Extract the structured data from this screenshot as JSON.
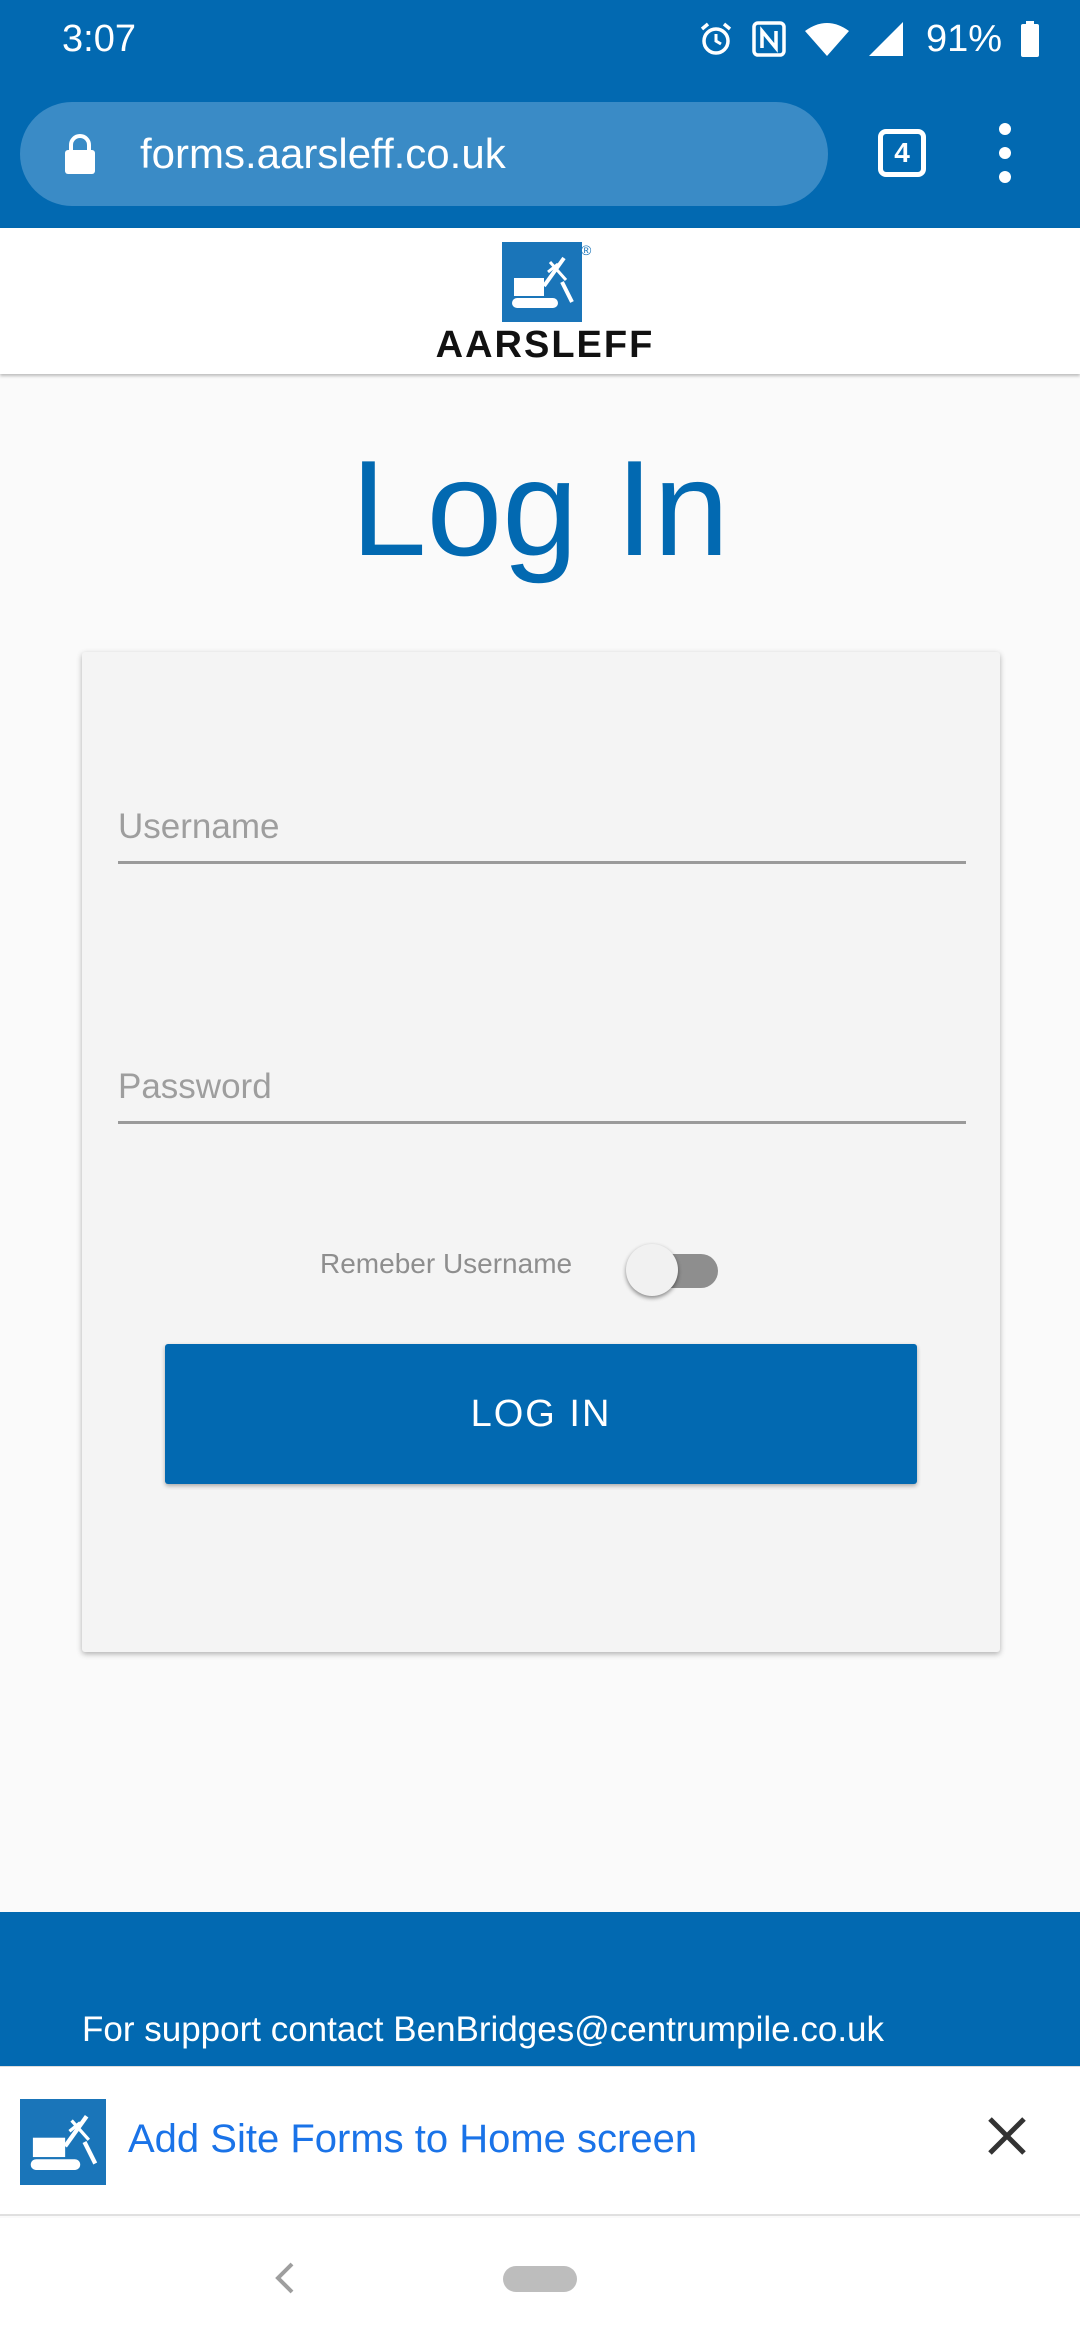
{
  "status_bar": {
    "time": "3:07",
    "battery": "91%",
    "icons": [
      "alarm-icon",
      "nfc-icon",
      "wifi-icon",
      "signal-icon",
      "battery-icon"
    ]
  },
  "browser": {
    "url": "forms.aarsleff.co.uk",
    "tab_count": "4",
    "icons": [
      "lock-icon",
      "tabs-icon",
      "more-vert-icon"
    ]
  },
  "header": {
    "logo_text": "AARSLEFF",
    "logo_reg": "®"
  },
  "login": {
    "title": "Log In",
    "username_placeholder": "Username",
    "password_placeholder": "Password",
    "remember_label": "Remeber Username",
    "remember_enabled": false,
    "button_label": "LOG IN"
  },
  "footer": {
    "support_text": "For support contact BenBridges@centrumpile.co.uk"
  },
  "banner": {
    "text": "Add Site Forms to Home screen"
  },
  "colors": {
    "primary": "#0269b1",
    "url_pill": "#3a8bc6",
    "banner_link": "#1a73e8",
    "card_bg": "#f4f4f4"
  }
}
